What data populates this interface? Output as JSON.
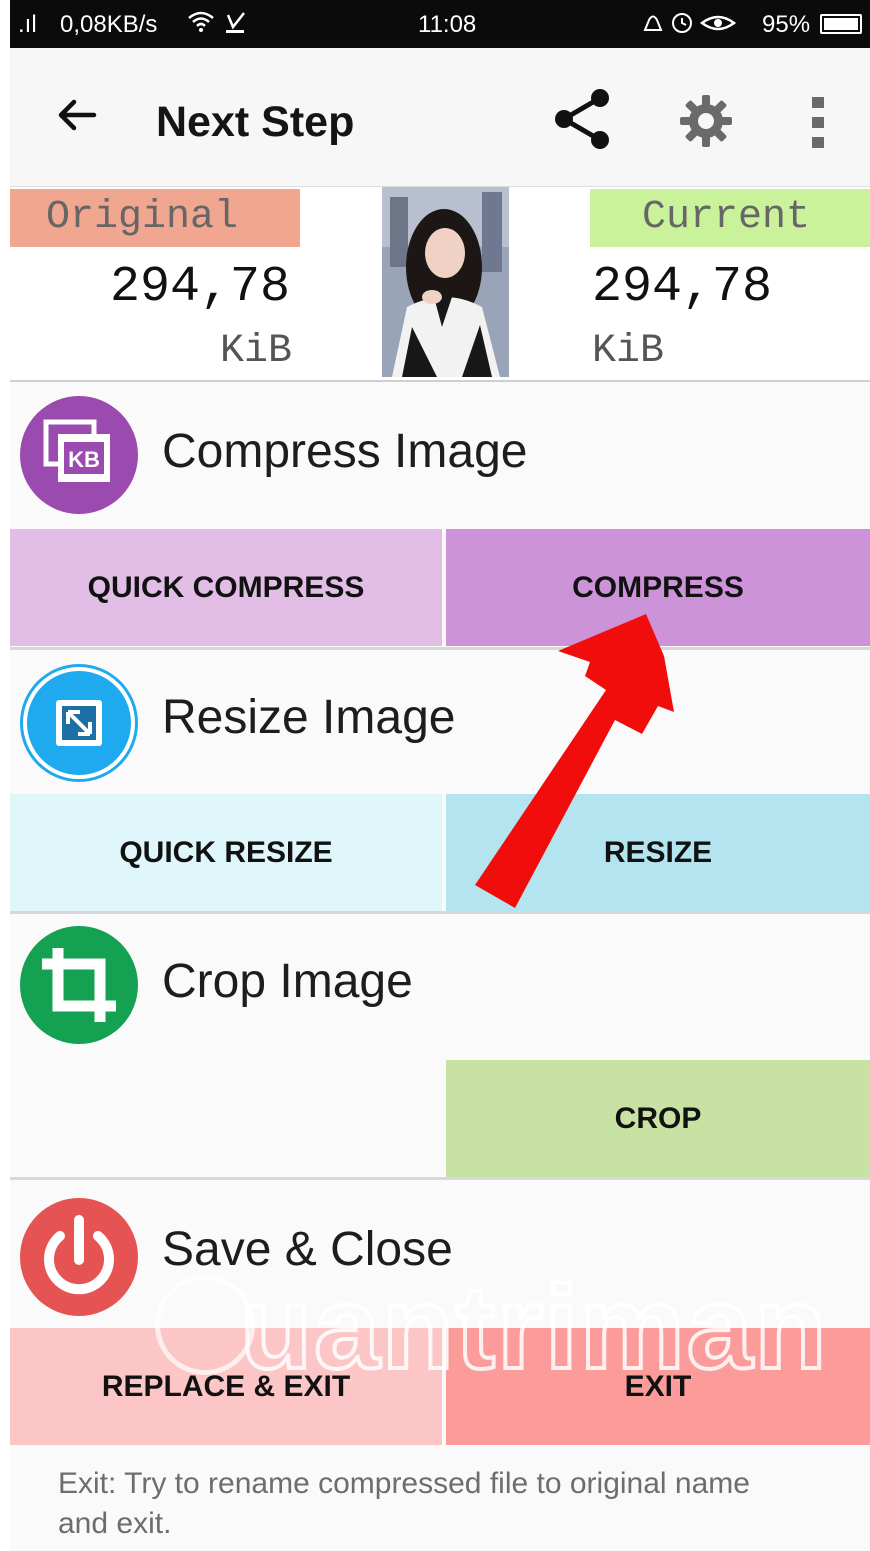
{
  "status_bar": {
    "signal": ".ıl",
    "network_speed": "0,08KB/s",
    "time": "11:08",
    "battery": "95%"
  },
  "toolbar": {
    "back_icon": "arrow-left-icon",
    "title": "Next Step",
    "share_icon": "share-icon",
    "settings_icon": "gear-icon",
    "more_icon": "more-vertical-icon"
  },
  "size_info": {
    "original_label": "Original",
    "original_value": "294,78",
    "original_unit": "KiB",
    "current_label": "Current",
    "current_value": "294,78",
    "current_unit": "KiB"
  },
  "sections": {
    "compress": {
      "title": "Compress Image",
      "icon": "compress-kb-icon",
      "icon_color": "#9b4ab0",
      "quick_label": "QUICK COMPRESS",
      "main_label": "COMPRESS",
      "quick_color": "#e2bde6",
      "main_color": "#cd93d8"
    },
    "resize": {
      "title": "Resize Image",
      "icon": "resize-icon",
      "icon_color": "#1fa9ee",
      "quick_label": "QUICK RESIZE",
      "main_label": "RESIZE",
      "quick_color": "#dff7fb",
      "main_color": "#b4e4f0"
    },
    "crop": {
      "title": "Crop Image",
      "icon": "crop-icon",
      "icon_color": "#15a152",
      "main_label": "CROP",
      "main_color": "#c8e2a4"
    },
    "save": {
      "title": "Save & Close",
      "icon": "power-icon",
      "icon_color": "#e55353",
      "replace_label": "REPLACE & EXIT",
      "exit_label": "EXIT",
      "replace_color": "#fcc6c6",
      "exit_color": "#fb9c9a"
    }
  },
  "footer": {
    "line1": "Exit: Try to rename compressed file to original name",
    "line2": "and exit."
  },
  "watermark": "Quantrimang"
}
